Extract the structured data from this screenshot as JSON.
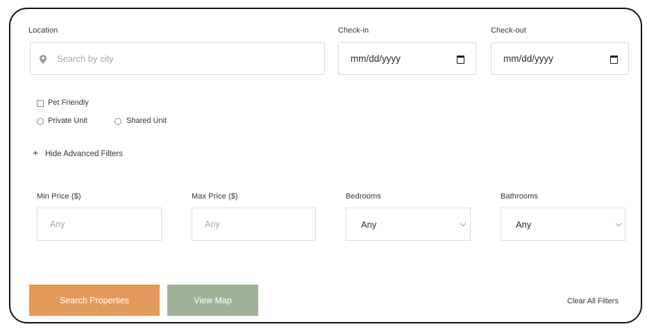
{
  "location": {
    "label": "Location",
    "placeholder": "Search by city"
  },
  "checkin": {
    "label": "Check-in",
    "value": "mm/dd/yyyy"
  },
  "checkout": {
    "label": "Check-out",
    "value": "mm/dd/yyyy"
  },
  "options": {
    "pet_friendly": "Pet Friendly",
    "private_unit": "Private Unit",
    "shared_unit": "Shared Unit"
  },
  "advanced_toggle": {
    "icon": "+",
    "label": "Hide Advanced Filters"
  },
  "advanced": {
    "min_price": {
      "label": "Min Price ($)",
      "placeholder": "Any"
    },
    "max_price": {
      "label": "Max Price ($)",
      "placeholder": "Any"
    },
    "bedrooms": {
      "label": "Bedrooms",
      "value": "Any"
    },
    "bathrooms": {
      "label": "Bathrooms",
      "value": "Any"
    }
  },
  "buttons": {
    "search": "Search Properties",
    "view_map": "View Map",
    "clear": "Clear All Filters"
  },
  "colors": {
    "search_button": "#e39a5b",
    "view_map_button": "#9fb298",
    "border": "#111111"
  }
}
